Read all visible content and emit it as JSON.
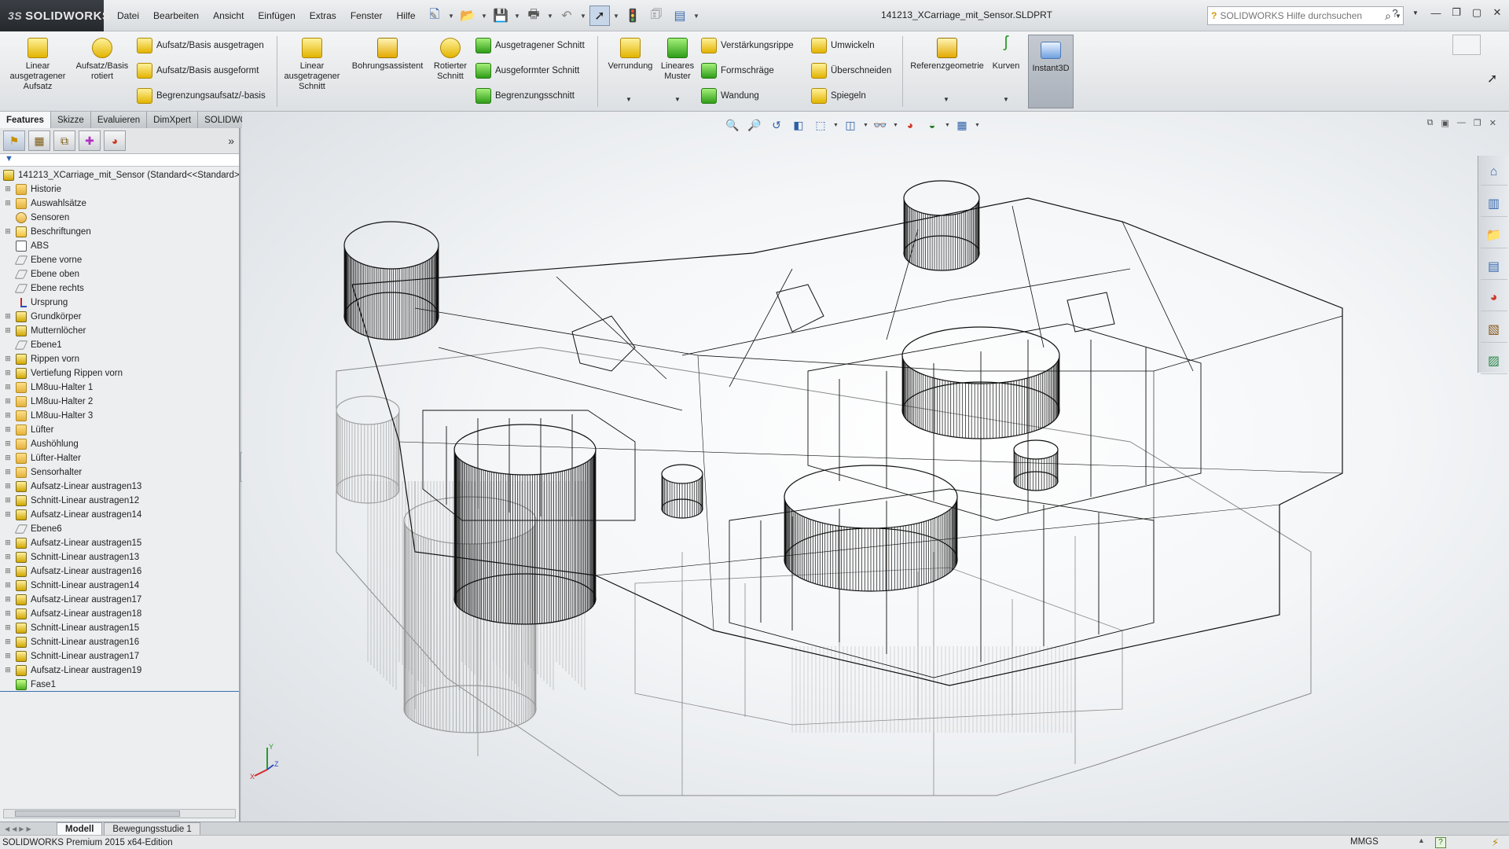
{
  "app": {
    "logo_prefix": "3S",
    "logo_text": "SOLIDWORKS",
    "doc_title": "141213_XCarriage_mit_Sensor.SLDPRT"
  },
  "menu": [
    "Datei",
    "Bearbeiten",
    "Ansicht",
    "Einfügen",
    "Extras",
    "Fenster",
    "Hilfe"
  ],
  "search": {
    "placeholder": "SOLIDWORKS Hilfe durchsuchen"
  },
  "ribbon": {
    "linear_aufsatz": "Linear ausgetragener Aufsatz",
    "aufsatz_rotiert": "Aufsatz/Basis rotiert",
    "aufsatz_ausgetragen": "Aufsatz/Basis ausgetragen",
    "aufsatz_ausgeformt": "Aufsatz/Basis ausgeformt",
    "begrenzungsaufsatz": "Begrenzungsaufsatz/-basis",
    "linear_schnitt": "Linear ausgetragener Schnitt",
    "bohrungsassistent": "Bohrungsassistent",
    "rotierter_schnitt": "Rotierter Schnitt",
    "ausgetragener_schnitt": "Ausgetragener Schnitt",
    "ausgeformter_schnitt": "Ausgeformter Schnitt",
    "begrenzungsschnitt": "Begrenzungsschnitt",
    "verrundung": "Verrundung",
    "lineares_muster": "Lineares Muster",
    "verstaerkungsrippe": "Verstärkungsrippe",
    "formschraege": "Formschräge",
    "wandung": "Wandung",
    "umwickeln": "Umwickeln",
    "ueberschneiden": "Überschneiden",
    "spiegeln": "Spiegeln",
    "referenzgeometrie": "Referenzgeometrie",
    "kurven": "Kurven",
    "instant3d": "Instant3D"
  },
  "tabs": [
    "Features",
    "Skizze",
    "Evaluieren",
    "DimXpert",
    "SOLIDWORKS Zusatzanwendungen"
  ],
  "tree": {
    "root": "141213_XCarriage_mit_Sensor  (Standard<<Standard>",
    "items": [
      {
        "label": "Historie",
        "icon": "folder",
        "exp": true
      },
      {
        "label": "Auswahlsätze",
        "icon": "folder",
        "exp": true
      },
      {
        "label": "Sensoren",
        "icon": "sensor",
        "exp": false
      },
      {
        "label": "Beschriftungen",
        "icon": "anno",
        "exp": true
      },
      {
        "label": "ABS",
        "icon": "equ",
        "exp": false
      },
      {
        "label": "Ebene vorne",
        "icon": "plane",
        "exp": false
      },
      {
        "label": "Ebene oben",
        "icon": "plane",
        "exp": false
      },
      {
        "label": "Ebene rechts",
        "icon": "plane",
        "exp": false
      },
      {
        "label": "Ursprung",
        "icon": "origin",
        "exp": false
      },
      {
        "label": "Grundkörper",
        "icon": "feat",
        "exp": true
      },
      {
        "label": "Mutternlöcher",
        "icon": "feat",
        "exp": true
      },
      {
        "label": "Ebene1",
        "icon": "plane",
        "exp": false
      },
      {
        "label": "Rippen vorn",
        "icon": "feat",
        "exp": true
      },
      {
        "label": "Vertiefung Rippen vorn",
        "icon": "feat",
        "exp": true
      },
      {
        "label": "LM8uu-Halter 1",
        "icon": "folder",
        "exp": true
      },
      {
        "label": "LM8uu-Halter 2",
        "icon": "folder",
        "exp": true
      },
      {
        "label": "LM8uu-Halter 3",
        "icon": "folder",
        "exp": true
      },
      {
        "label": "Lüfter",
        "icon": "folder",
        "exp": true
      },
      {
        "label": "Aushöhlung",
        "icon": "folder",
        "exp": true
      },
      {
        "label": "Lüfter-Halter",
        "icon": "folder",
        "exp": true
      },
      {
        "label": "Sensorhalter",
        "icon": "folder",
        "exp": true
      },
      {
        "label": "Aufsatz-Linear austragen13",
        "icon": "feat",
        "exp": true
      },
      {
        "label": "Schnitt-Linear austragen12",
        "icon": "feat",
        "exp": true
      },
      {
        "label": "Aufsatz-Linear austragen14",
        "icon": "feat",
        "exp": true
      },
      {
        "label": "Ebene6",
        "icon": "plane",
        "exp": false
      },
      {
        "label": "Aufsatz-Linear austragen15",
        "icon": "feat",
        "exp": true
      },
      {
        "label": "Schnitt-Linear austragen13",
        "icon": "feat",
        "exp": true
      },
      {
        "label": "Aufsatz-Linear austragen16",
        "icon": "feat",
        "exp": true
      },
      {
        "label": "Schnitt-Linear austragen14",
        "icon": "feat",
        "exp": true
      },
      {
        "label": "Aufsatz-Linear austragen17",
        "icon": "feat",
        "exp": true
      },
      {
        "label": "Aufsatz-Linear austragen18",
        "icon": "feat",
        "exp": true
      },
      {
        "label": "Schnitt-Linear austragen15",
        "icon": "feat",
        "exp": true
      },
      {
        "label": "Schnitt-Linear austragen16",
        "icon": "feat",
        "exp": true
      },
      {
        "label": "Schnitt-Linear austragen17",
        "icon": "feat",
        "exp": true
      },
      {
        "label": "Aufsatz-Linear austragen19",
        "icon": "feat",
        "exp": true
      },
      {
        "label": "Fase1",
        "icon": "fase",
        "exp": false
      }
    ]
  },
  "triad": {
    "x": "X",
    "y": "Y",
    "z": "Z"
  },
  "model_tabs": [
    "Modell",
    "Bewegungsstudie 1"
  ],
  "status": {
    "edition": "SOLIDWORKS Premium 2015 x64-Edition",
    "units": "MMGS"
  }
}
